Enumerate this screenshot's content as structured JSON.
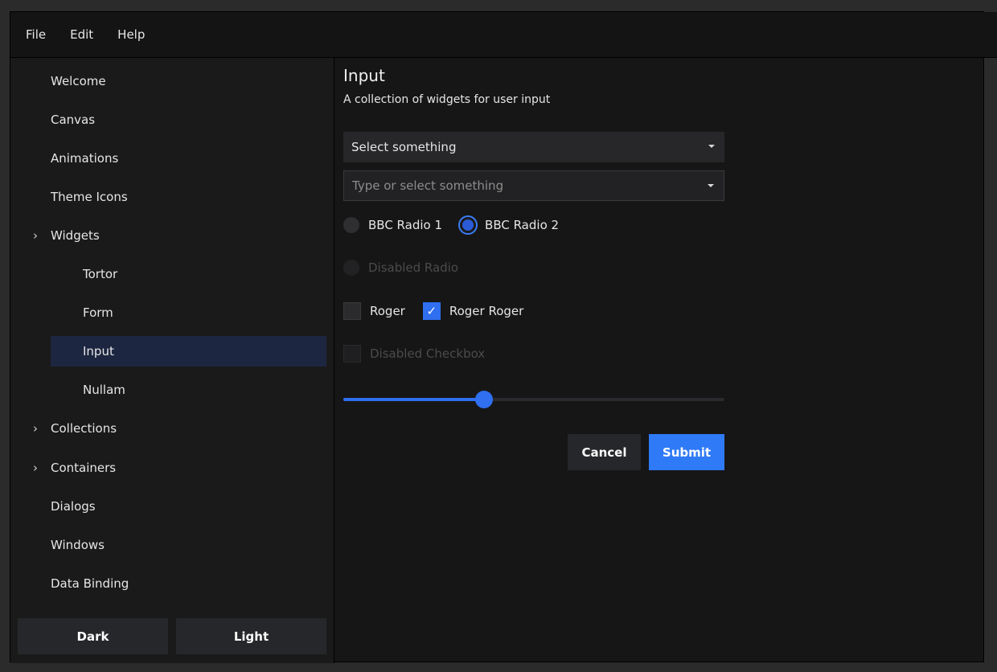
{
  "menubar": {
    "items": [
      "File",
      "Edit",
      "Help"
    ]
  },
  "sidebar": {
    "items": [
      {
        "label": "Welcome"
      },
      {
        "label": "Canvas"
      },
      {
        "label": "Animations"
      },
      {
        "label": "Theme Icons"
      },
      {
        "label": "Widgets",
        "expandable": true
      },
      {
        "label": "Tortor",
        "child": true
      },
      {
        "label": "Form",
        "child": true
      },
      {
        "label": "Input",
        "child": true,
        "selected": true
      },
      {
        "label": "Nullam",
        "child": true
      },
      {
        "label": "Collections",
        "expandable": true
      },
      {
        "label": "Containers",
        "expandable": true
      },
      {
        "label": "Dialogs"
      },
      {
        "label": "Windows"
      },
      {
        "label": "Data Binding"
      }
    ],
    "theme_buttons": {
      "dark": "Dark",
      "light": "Light"
    }
  },
  "main": {
    "title": "Input",
    "subtitle": "A collection of widgets for user input",
    "select": {
      "value": "Select something"
    },
    "combo": {
      "placeholder": "Type or select something"
    },
    "radios": {
      "radio1": "BBC Radio 1",
      "radio2": "BBC Radio 2",
      "disabled": "Disabled Radio",
      "selected": "BBC Radio 2"
    },
    "checks": {
      "check1": "Roger",
      "check2": "Roger Roger",
      "disabled": "Disabled Checkbox",
      "checked": [
        "Roger Roger"
      ]
    },
    "slider": {
      "value": 0.37
    },
    "buttons": {
      "cancel": "Cancel",
      "submit": "Submit"
    }
  },
  "colors": {
    "accent": "#2f7af7",
    "selected_row": "#1d2640",
    "background": "#161616"
  }
}
